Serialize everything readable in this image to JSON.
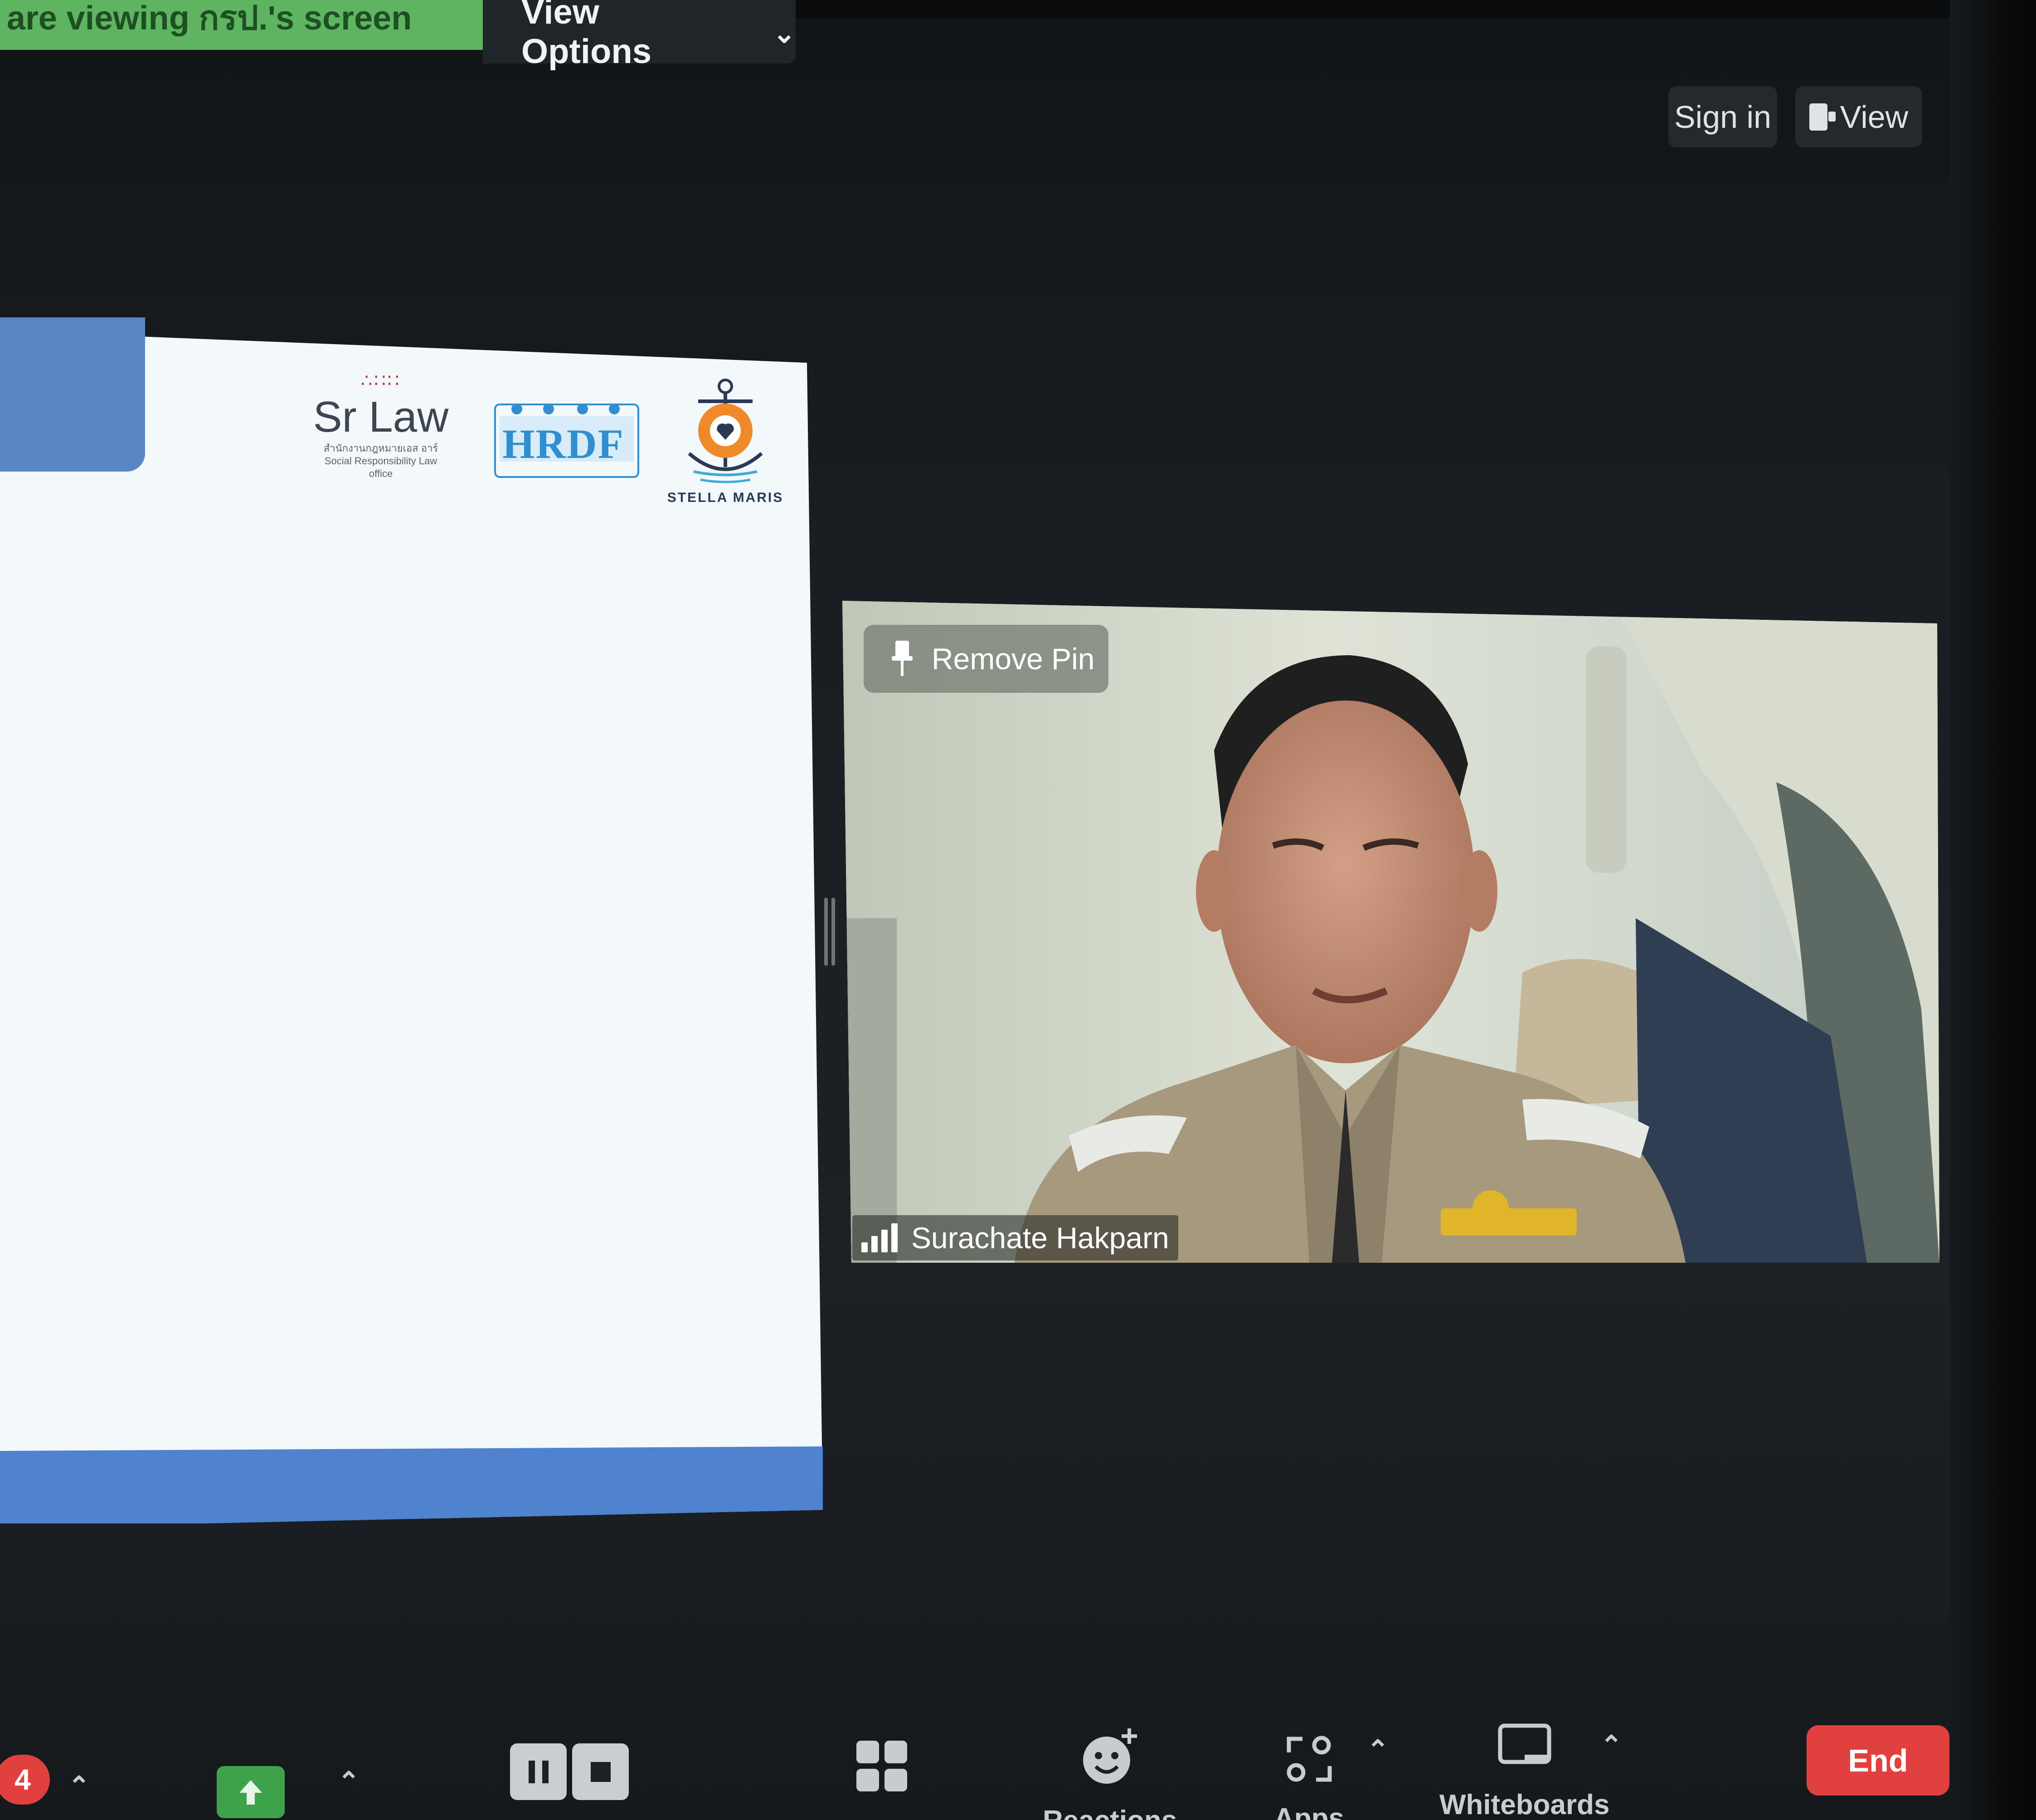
{
  "share_banner": {
    "text": "You are viewing กรป.'s screen"
  },
  "view_options": {
    "label": "View Options"
  },
  "top_right": {
    "sign_in": "Sign in",
    "view": "View"
  },
  "slide": {
    "logos": {
      "srlaw_name": "Sr Law",
      "srlaw_sub_th": "สำนักงานกฎหมายเอส อาร์",
      "srlaw_sub_en": "Social Responsibility Law office",
      "hrdf_name": "HRDF",
      "stella_name": "STELLA MARIS"
    }
  },
  "video": {
    "pin_label": "Remove Pin",
    "participant_name": "Surachate Hakparn"
  },
  "toolbar": {
    "badge_count": "4",
    "reactions_label": "Reactions",
    "apps_label": "Apps",
    "whiteboards_label": "Whiteboards",
    "end_label": "End"
  },
  "colors": {
    "banner_green": "#5fb462",
    "end_red": "#e0413f",
    "share_green": "#3ea24a",
    "slide_blue": "#4f82cf"
  }
}
